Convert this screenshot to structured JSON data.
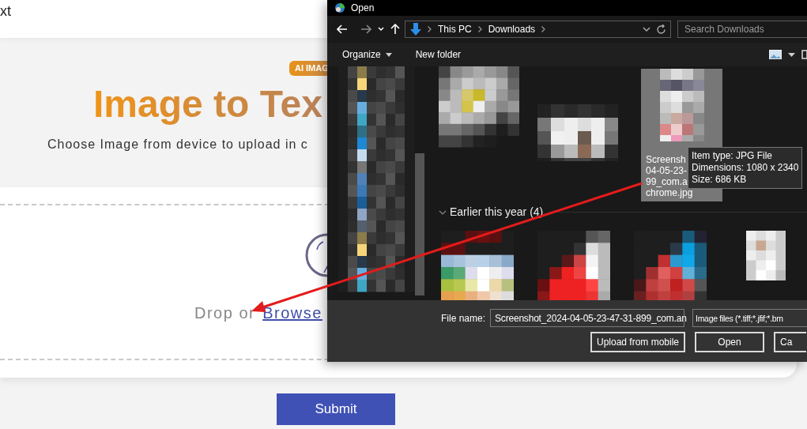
{
  "page": {
    "header_text": "xt",
    "badge": "AI IMAG",
    "title": "Image to Tex",
    "subtitle": "Choose Image from device to upload in c",
    "drop_text": "Drop or",
    "browse_link": "Browse",
    "submit": "Submit"
  },
  "dialog": {
    "title": "Open",
    "breadcrumb": [
      "This PC",
      "Downloads"
    ],
    "search_placeholder": "Search Downloads",
    "toolbar": [
      "Organize",
      "New folder"
    ],
    "recent_files": [
      {
        "selected": false
      },
      {
        "selected": false
      },
      {
        "selected": true,
        "caption": [
          "Screensh",
          "04-05-23-",
          "99_com.a",
          "chrome.jpg"
        ]
      }
    ],
    "group": {
      "label": "Earlier this year (4)",
      "expanded": true
    },
    "tooltip": [
      "Item type: JPG File",
      "Dimensions: 1080 x 2340",
      "Size: 686 KB"
    ],
    "file_name_label": "File name:",
    "file_name": "Screenshot_2024-04-05-23-47-31-899_com.an",
    "file_type": "Image files (*.tiff;*.jfif;*.bm",
    "buttons": [
      "Upload from mobile",
      "Open",
      "Ca"
    ]
  }
}
